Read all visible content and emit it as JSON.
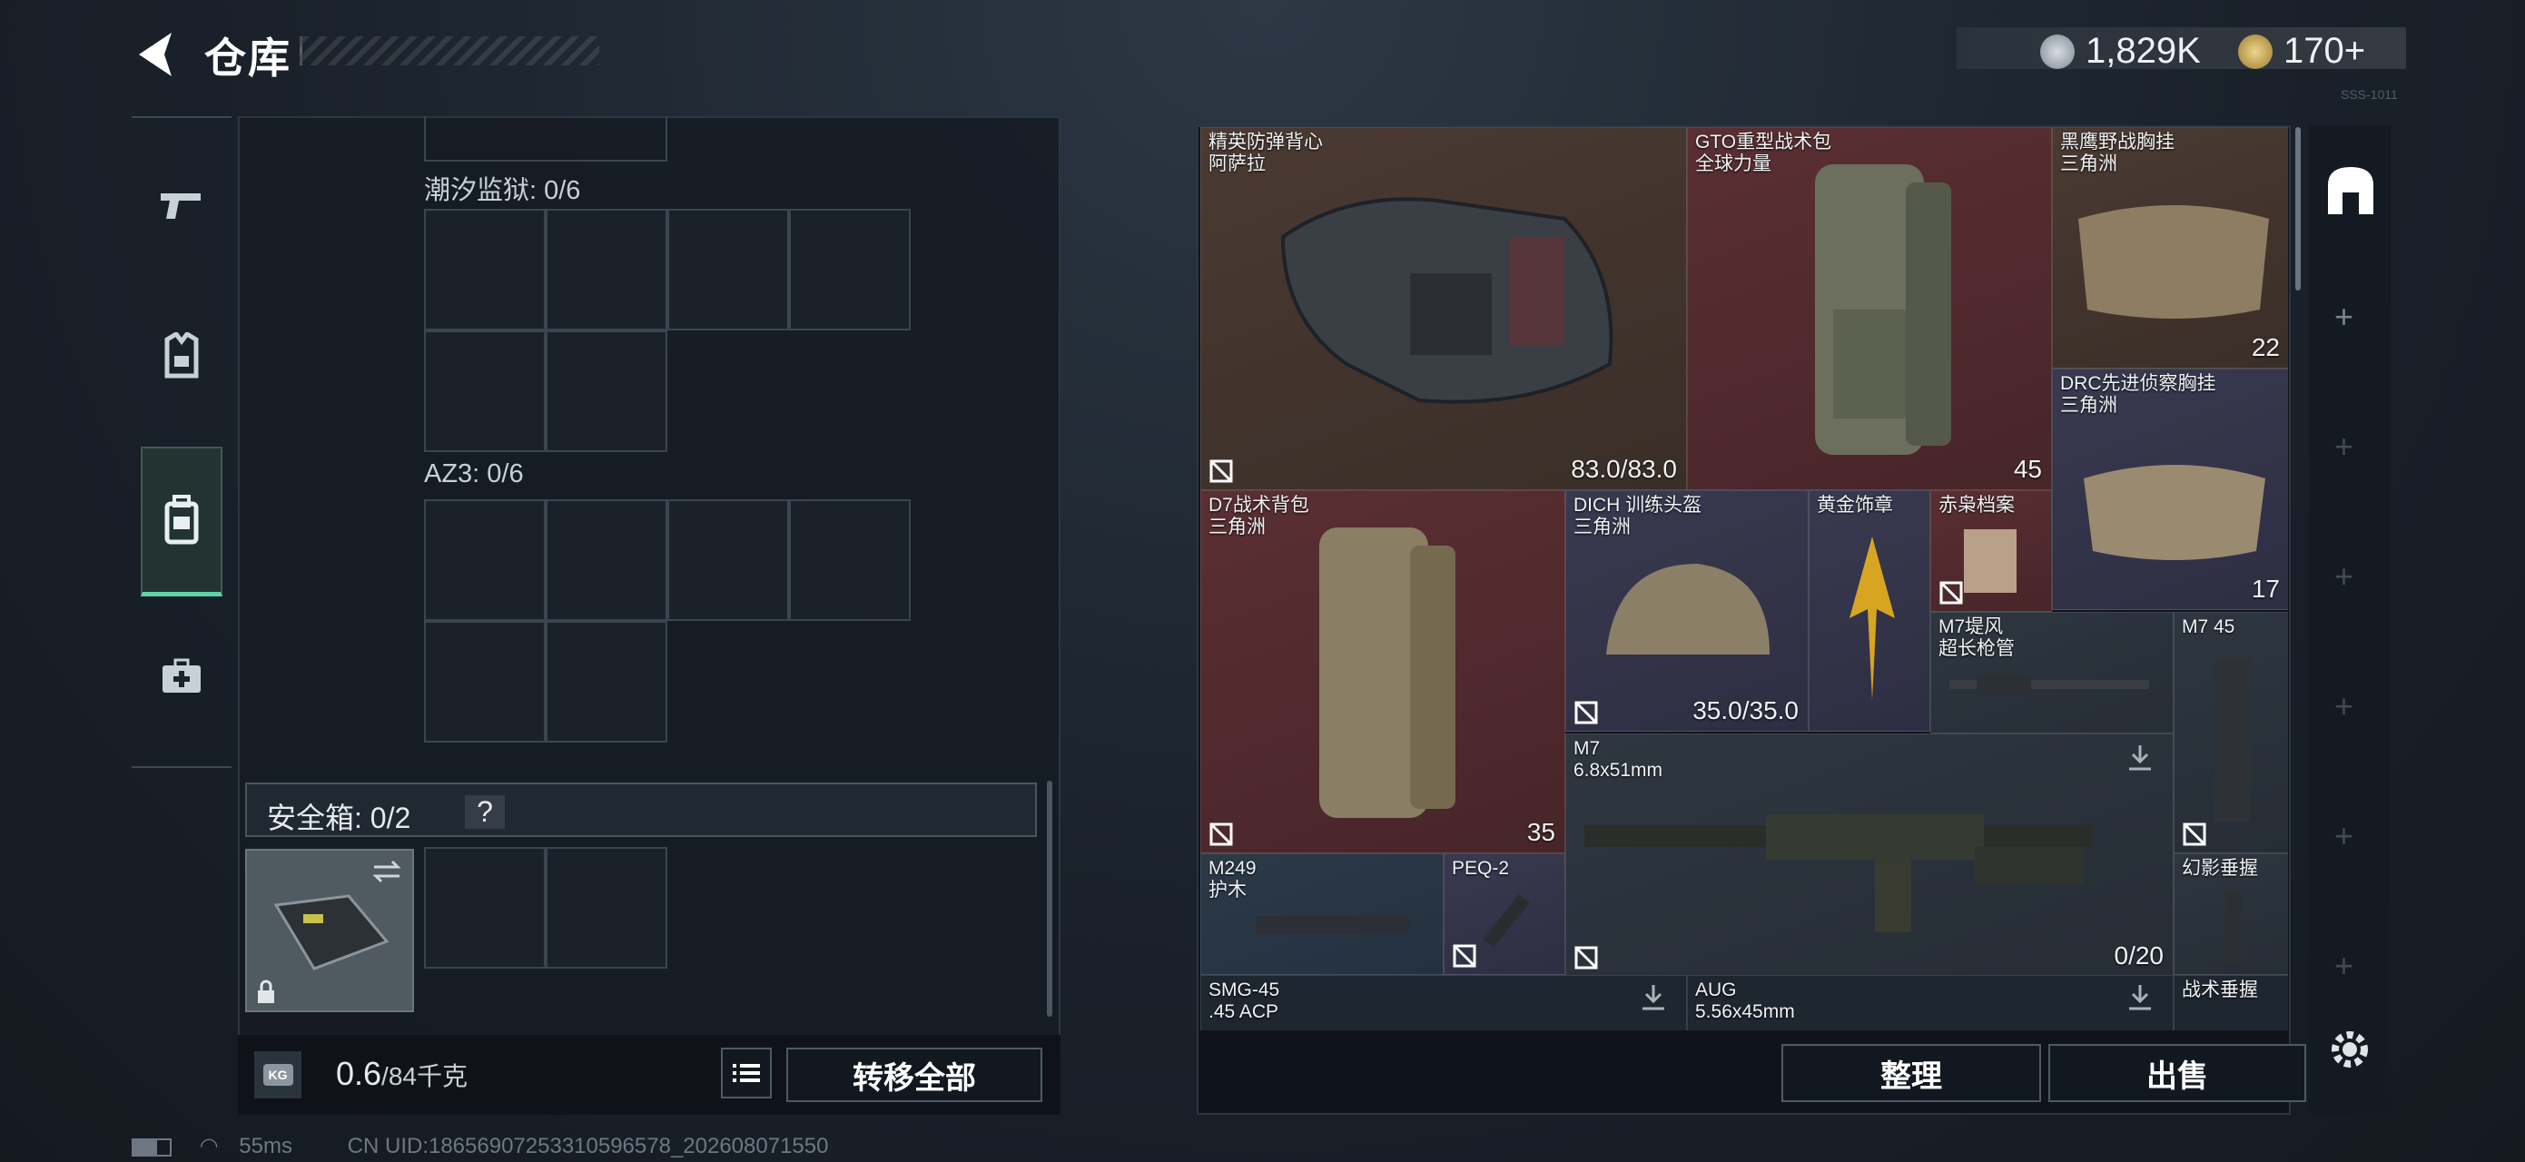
{
  "header": {
    "title": "仓库",
    "currency1": "1,829K",
    "currency2": "170+",
    "corner_text": "SSS-1011"
  },
  "left_panel": {
    "grid1_label": "潮汐监狱: 0/6",
    "grid2_label": "AZ3: 0/6",
    "safebox_label": "安全箱: 0/2",
    "safebox_help": "?",
    "weight_value": "0.6",
    "weight_max": "/84千克",
    "weight_icon_text": "KG",
    "transfer_all": "转移全部"
  },
  "items": [
    {
      "name": "精英防弹背心\n阿萨拉",
      "value": "83.0/83.0",
      "bg": "brown"
    },
    {
      "name": "GTO重型战术包\n全球力量",
      "value": "45",
      "bg": "red"
    },
    {
      "name": "黑鹰野战胸挂\n三角洲",
      "value": "22",
      "bg": "brown"
    },
    {
      "name": "DRC先进侦察胸挂\n三角洲",
      "value": "17",
      "bg": "purple"
    },
    {
      "name": "D7战术背包\n三角洲",
      "value": "35",
      "bg": "red"
    },
    {
      "name": "DICH 训练头盔\n三角洲",
      "value": "35.0/35.0",
      "bg": "purple"
    },
    {
      "name": "黄金饰章",
      "value": "",
      "bg": "purple"
    },
    {
      "name": "赤枭档案",
      "value": "",
      "bg": "red"
    },
    {
      "name": "M7堤风\n超长枪管",
      "value": "",
      "bg": "gray"
    },
    {
      "name": "M7 45",
      "value": "",
      "bg": "gray"
    },
    {
      "name": "M7\n6.8x51mm",
      "value": "0/20",
      "bg": "gray"
    },
    {
      "name": "M249\n护木",
      "value": "",
      "bg": "blue"
    },
    {
      "name": "PEQ-2",
      "value": "",
      "bg": "purple"
    },
    {
      "name": "幻影垂握",
      "value": "",
      "bg": "gray"
    },
    {
      "name": "SMG-45\n.45 ACP",
      "value": "",
      "bg": "gray"
    },
    {
      "name": "AUG\n5.56x45mm",
      "value": "",
      "bg": "gray"
    },
    {
      "name": "战术垂握",
      "value": "",
      "bg": "gray"
    }
  ],
  "right_footer": {
    "sort": "整理",
    "sell": "出售"
  },
  "status": {
    "ping": "55ms",
    "uid": "CN UID:18656907253310596578_202608071550"
  }
}
